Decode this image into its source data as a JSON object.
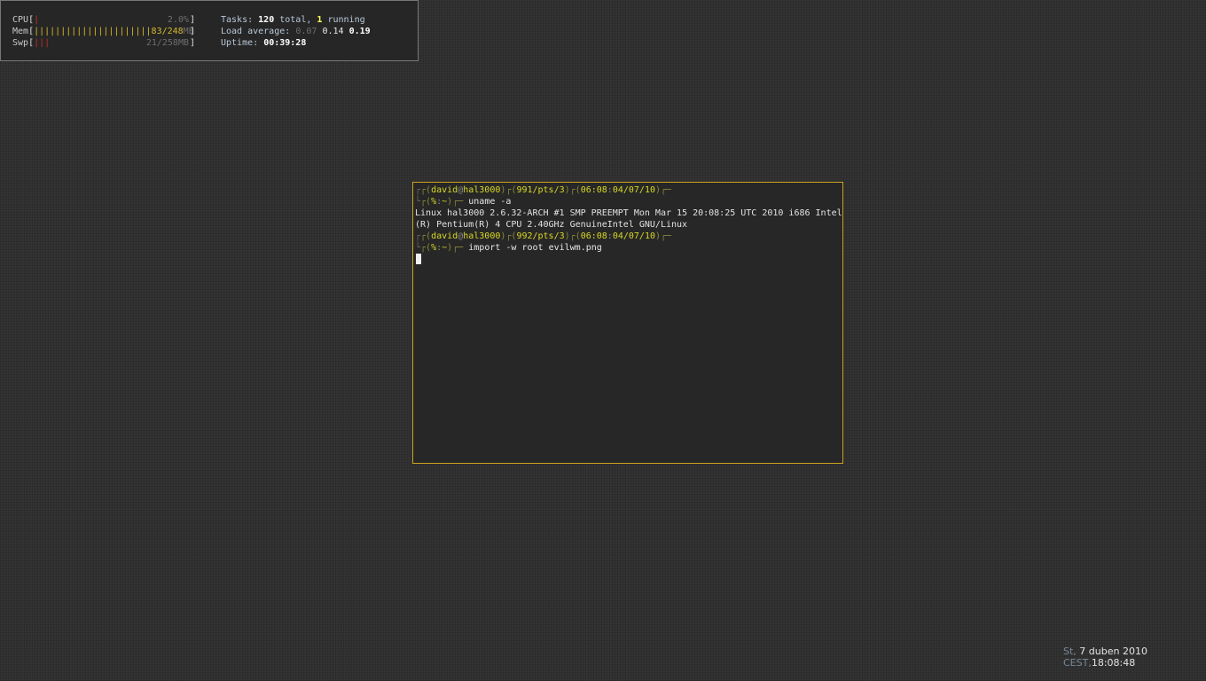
{
  "htop": {
    "cpu": {
      "label": "CPU",
      "bars": "|",
      "value": "2.0%"
    },
    "mem": {
      "label": "Mem",
      "bars": "||||||||||||||||||||||",
      "value_used": "83/248",
      "value_unit": "MB"
    },
    "swp": {
      "label": "Swp",
      "bars": "|||",
      "value": "21/258MB"
    },
    "tasks_label": "Tasks:",
    "tasks_total": "120",
    "tasks_total_suffix": "total,",
    "tasks_running": "1",
    "tasks_running_suffix": "running",
    "load_label": "Load average:",
    "load_1": "0.07",
    "load_5": "0.14",
    "load_15": "0.19",
    "uptime_label": "Uptime:",
    "uptime_value": "00:39:28"
  },
  "terminal": {
    "prompt1": {
      "user": "david",
      "at": "@",
      "host": "hal3000",
      "histnum": "991",
      "tty": "/pts/3",
      "time": "06:08",
      "date": "04/07/10",
      "exit": "%",
      "cwd": "~"
    },
    "cmd1": "uname -a",
    "output1_line1": "Linux hal3000 2.6.32-ARCH #1 SMP PREEMPT Mon Mar 15 20:08:25 UTC 2010 i686 Intel",
    "output1_line2": "(R) Pentium(R) 4 CPU 2.40GHz GenuineIntel GNU/Linux",
    "prompt2": {
      "user": "david",
      "at": "@",
      "host": "hal3000",
      "histnum": "992",
      "tty": "/pts/3",
      "time": "06:08",
      "date": "04/07/10",
      "exit": "%",
      "cwd": "~"
    },
    "cmd2": "import -w root evilwm.png"
  },
  "clock": {
    "weekday": "St,",
    "date": "7 duben 2010",
    "tz": "CEST,",
    "time": "18:08:48"
  },
  "colors": {
    "desktop_bg": "#333333",
    "terminal_border": "#c9a31f",
    "prompt_yellow": "#d8d827"
  }
}
